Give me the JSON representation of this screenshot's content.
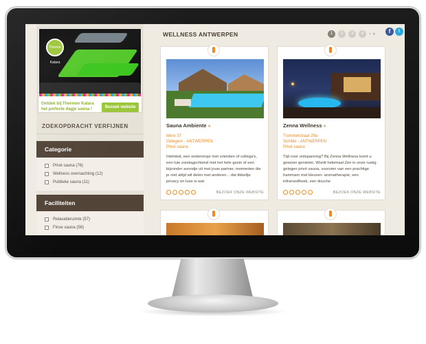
{
  "promo": {
    "logo_text": "Therme Katara",
    "text": "Ontdek bij Thermen Katara het perfecte dagje sauna !",
    "button": "Bezoek website"
  },
  "sidebar": {
    "refine_title": "ZOEKOPDRACHT VERFIJNEN",
    "categorie": {
      "title": "Categorie",
      "items": [
        "Privé sauna (76)",
        "Wellness overnachting (12)",
        "Publieke sauna (11)"
      ]
    },
    "faciliteiten": {
      "title": "Faciliteiten",
      "items": [
        "Relaxatieruimte (57)",
        "Finse sauna (56)"
      ]
    }
  },
  "main": {
    "title": "WELLNESS ANTWERPEN",
    "pager": [
      "1",
      "2",
      "3",
      "4"
    ],
    "pager_next": "›",
    "pager_last": "»",
    "social": {
      "facebook": "f",
      "twitter": "t"
    }
  },
  "cards": [
    {
      "title": "Sauna Ambiente",
      "arrows": "»",
      "address_line1": "Mere 37",
      "address_line2": "Oelegem - ANTWERPEN",
      "type": "Privé sauna",
      "description": "Intimiteit, een onderonsje met vrienden of collega's, een luie zondagschtend met het hele gezin of een bijzonder avondje uit met jouw partner, momenten die je niet altijd wil delen met anderen... dat tikkeltje privacy en luxe is wat",
      "visit": "BEZOEK ONZE WEBSITE"
    },
    {
      "title": "Zenna Wellness",
      "arrows": "»",
      "address_line1": "Trommelstraat 29a",
      "address_line2": "Schilde - ANTWERPEN",
      "type": "Privé sauna",
      "description": "Tijd voor ontspanning? Bij Zenna Wellness komt u gewoon genieten. Wordt helemaal Zen in onze rustig gelegen privé sauna, voorzien van een prachtige hammam met kleuren- aromatherapie, een infraroodhoek, een douche",
      "visit": "BEZOEK ONZE WEBSITE"
    }
  ],
  "colors": {
    "accent_orange": "#f08a1e",
    "sidebar_header": "#524437",
    "promo_green": "#9cc63a"
  }
}
